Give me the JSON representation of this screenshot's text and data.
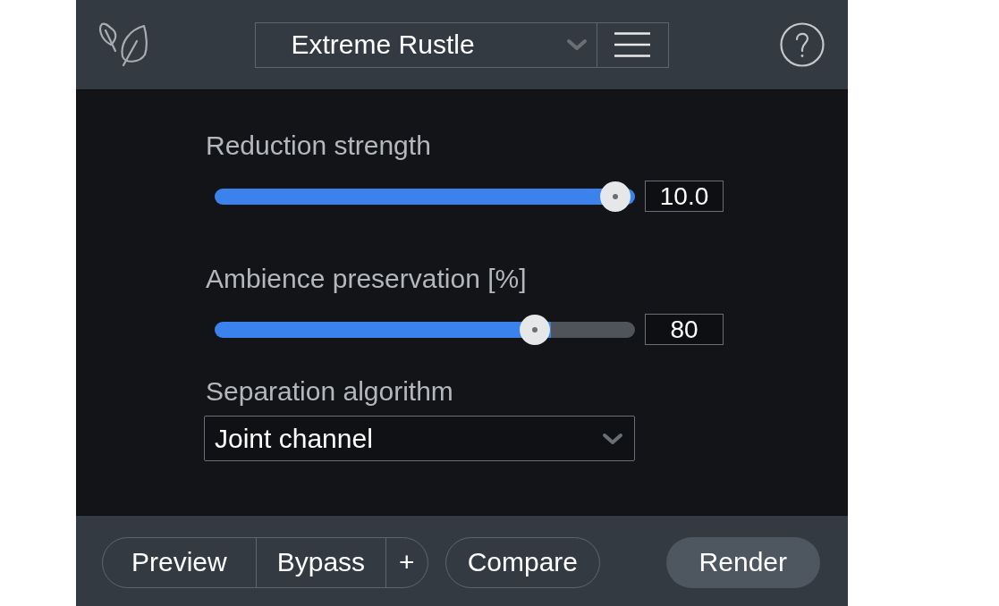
{
  "toolbar": {
    "preset": "Extreme Rustle"
  },
  "controls": [
    {
      "kind": "slider",
      "label": "Reduction strength",
      "level": 1.0,
      "reading": "10.0"
    },
    {
      "kind": "slider",
      "label": "Ambience preservation [%]",
      "level": 0.8,
      "reading": "80"
    },
    {
      "kind": "dropdown",
      "label": "Separation algorithm",
      "value": "Joint channel"
    }
  ],
  "footer": {
    "button_group": [
      "Preview",
      "Bypass",
      "+"
    ],
    "compare": "Compare",
    "render": "Render"
  }
}
